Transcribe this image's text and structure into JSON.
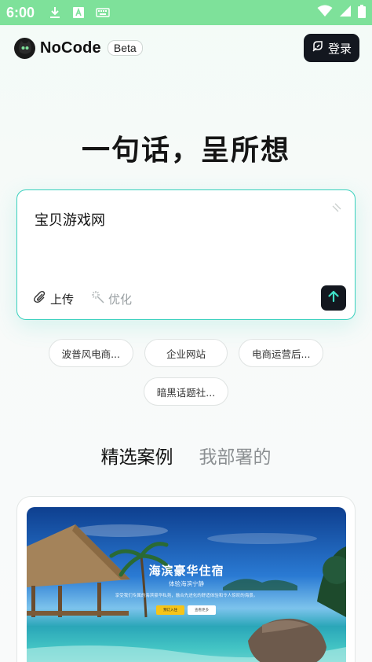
{
  "status_bar": {
    "time": "6:00",
    "icons": [
      "download-icon",
      "a-badge-icon",
      "keyboard-icon",
      "wifi-icon",
      "signal-icon",
      "battery-icon"
    ],
    "background": "#7ee19a"
  },
  "header": {
    "brand": "NoCode",
    "badge": "Beta",
    "login_label": "登录"
  },
  "hero": {
    "title": "一句话，呈所想"
  },
  "prompt": {
    "value": "宝贝游戏网",
    "upload_label": "上传",
    "optimize_label": "优化",
    "accent": "#38d0bd"
  },
  "suggestions": [
    {
      "label": "波普风电商..."
    },
    {
      "label": "企业网站"
    },
    {
      "label": "电商运营后..."
    },
    {
      "label": "暗黑话题社..."
    }
  ],
  "tabs": [
    {
      "label": "精选案例",
      "active": true
    },
    {
      "label": "我部署的",
      "active": false
    }
  ],
  "case": {
    "title": "海滨豪华住宿",
    "subtitle": "体验海滨宁静",
    "description": "享受我们专属的海滨豪华私苑，融合先进化的舒适体验和令人惊叹的海景。",
    "primary_button": "预订入住",
    "secondary_button": "查看更多"
  }
}
